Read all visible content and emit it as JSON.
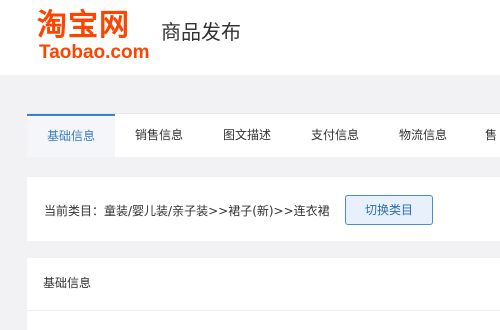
{
  "header": {
    "logo_cn": "淘宝网",
    "logo_en": "Taobao.com",
    "title": "商品发布",
    "brand_color": "#ff4400"
  },
  "tabs": [
    {
      "label": "基础信息",
      "active": true
    },
    {
      "label": "销售信息",
      "active": false
    },
    {
      "label": "图文描述",
      "active": false
    },
    {
      "label": "支付信息",
      "active": false
    },
    {
      "label": "物流信息",
      "active": false
    },
    {
      "label": "售",
      "active": false
    }
  ],
  "category": {
    "label": "当前类目：童装/婴儿装/亲子装>>裙子(新)>>连衣裙",
    "switch_button": "切换类目"
  },
  "section": {
    "title": "基础信息"
  }
}
